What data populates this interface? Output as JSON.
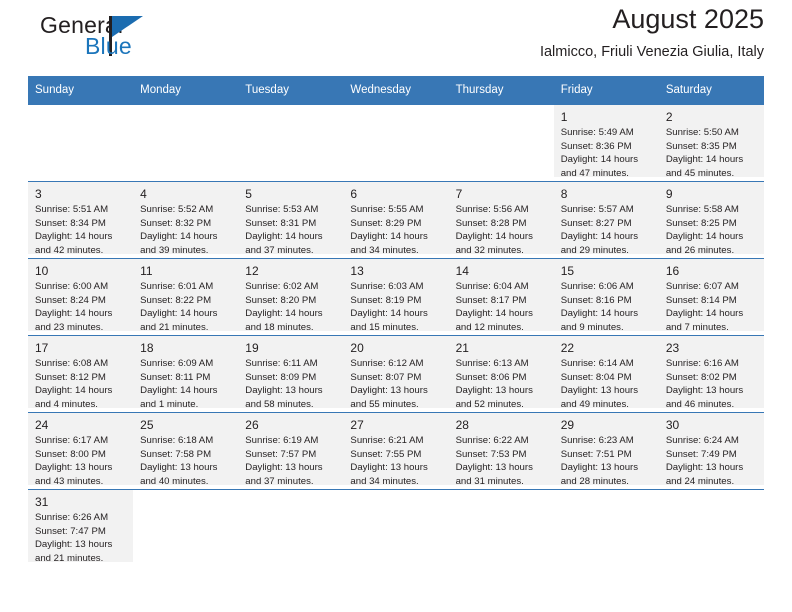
{
  "brand": {
    "name_top": "General",
    "name_bottom": "Blue",
    "color_black": "#231f20",
    "color_blue": "#1b75bb"
  },
  "header": {
    "title": "August 2025",
    "subtitle": "Ialmicco, Friuli Venezia Giulia, Italy"
  },
  "theme": {
    "header_blue": "#3877b5",
    "alt_row_gray": "#f2f2f2"
  },
  "weekdays": [
    "Sunday",
    "Monday",
    "Tuesday",
    "Wednesday",
    "Thursday",
    "Friday",
    "Saturday"
  ],
  "weeks": [
    [
      {
        "day": "",
        "sunrise": "",
        "sunset": "",
        "daylight_line1": "",
        "daylight_line2": ""
      },
      {
        "day": "",
        "sunrise": "",
        "sunset": "",
        "daylight_line1": "",
        "daylight_line2": ""
      },
      {
        "day": "",
        "sunrise": "",
        "sunset": "",
        "daylight_line1": "",
        "daylight_line2": ""
      },
      {
        "day": "",
        "sunrise": "",
        "sunset": "",
        "daylight_line1": "",
        "daylight_line2": ""
      },
      {
        "day": "",
        "sunrise": "",
        "sunset": "",
        "daylight_line1": "",
        "daylight_line2": ""
      },
      {
        "day": "1",
        "sunrise": "Sunrise: 5:49 AM",
        "sunset": "Sunset: 8:36 PM",
        "daylight_line1": "Daylight: 14 hours",
        "daylight_line2": "and 47 minutes."
      },
      {
        "day": "2",
        "sunrise": "Sunrise: 5:50 AM",
        "sunset": "Sunset: 8:35 PM",
        "daylight_line1": "Daylight: 14 hours",
        "daylight_line2": "and 45 minutes."
      }
    ],
    [
      {
        "day": "3",
        "sunrise": "Sunrise: 5:51 AM",
        "sunset": "Sunset: 8:34 PM",
        "daylight_line1": "Daylight: 14 hours",
        "daylight_line2": "and 42 minutes."
      },
      {
        "day": "4",
        "sunrise": "Sunrise: 5:52 AM",
        "sunset": "Sunset: 8:32 PM",
        "daylight_line1": "Daylight: 14 hours",
        "daylight_line2": "and 39 minutes."
      },
      {
        "day": "5",
        "sunrise": "Sunrise: 5:53 AM",
        "sunset": "Sunset: 8:31 PM",
        "daylight_line1": "Daylight: 14 hours",
        "daylight_line2": "and 37 minutes."
      },
      {
        "day": "6",
        "sunrise": "Sunrise: 5:55 AM",
        "sunset": "Sunset: 8:29 PM",
        "daylight_line1": "Daylight: 14 hours",
        "daylight_line2": "and 34 minutes."
      },
      {
        "day": "7",
        "sunrise": "Sunrise: 5:56 AM",
        "sunset": "Sunset: 8:28 PM",
        "daylight_line1": "Daylight: 14 hours",
        "daylight_line2": "and 32 minutes."
      },
      {
        "day": "8",
        "sunrise": "Sunrise: 5:57 AM",
        "sunset": "Sunset: 8:27 PM",
        "daylight_line1": "Daylight: 14 hours",
        "daylight_line2": "and 29 minutes."
      },
      {
        "day": "9",
        "sunrise": "Sunrise: 5:58 AM",
        "sunset": "Sunset: 8:25 PM",
        "daylight_line1": "Daylight: 14 hours",
        "daylight_line2": "and 26 minutes."
      }
    ],
    [
      {
        "day": "10",
        "sunrise": "Sunrise: 6:00 AM",
        "sunset": "Sunset: 8:24 PM",
        "daylight_line1": "Daylight: 14 hours",
        "daylight_line2": "and 23 minutes."
      },
      {
        "day": "11",
        "sunrise": "Sunrise: 6:01 AM",
        "sunset": "Sunset: 8:22 PM",
        "daylight_line1": "Daylight: 14 hours",
        "daylight_line2": "and 21 minutes."
      },
      {
        "day": "12",
        "sunrise": "Sunrise: 6:02 AM",
        "sunset": "Sunset: 8:20 PM",
        "daylight_line1": "Daylight: 14 hours",
        "daylight_line2": "and 18 minutes."
      },
      {
        "day": "13",
        "sunrise": "Sunrise: 6:03 AM",
        "sunset": "Sunset: 8:19 PM",
        "daylight_line1": "Daylight: 14 hours",
        "daylight_line2": "and 15 minutes."
      },
      {
        "day": "14",
        "sunrise": "Sunrise: 6:04 AM",
        "sunset": "Sunset: 8:17 PM",
        "daylight_line1": "Daylight: 14 hours",
        "daylight_line2": "and 12 minutes."
      },
      {
        "day": "15",
        "sunrise": "Sunrise: 6:06 AM",
        "sunset": "Sunset: 8:16 PM",
        "daylight_line1": "Daylight: 14 hours",
        "daylight_line2": "and 9 minutes."
      },
      {
        "day": "16",
        "sunrise": "Sunrise: 6:07 AM",
        "sunset": "Sunset: 8:14 PM",
        "daylight_line1": "Daylight: 14 hours",
        "daylight_line2": "and 7 minutes."
      }
    ],
    [
      {
        "day": "17",
        "sunrise": "Sunrise: 6:08 AM",
        "sunset": "Sunset: 8:12 PM",
        "daylight_line1": "Daylight: 14 hours",
        "daylight_line2": "and 4 minutes."
      },
      {
        "day": "18",
        "sunrise": "Sunrise: 6:09 AM",
        "sunset": "Sunset: 8:11 PM",
        "daylight_line1": "Daylight: 14 hours",
        "daylight_line2": "and 1 minute."
      },
      {
        "day": "19",
        "sunrise": "Sunrise: 6:11 AM",
        "sunset": "Sunset: 8:09 PM",
        "daylight_line1": "Daylight: 13 hours",
        "daylight_line2": "and 58 minutes."
      },
      {
        "day": "20",
        "sunrise": "Sunrise: 6:12 AM",
        "sunset": "Sunset: 8:07 PM",
        "daylight_line1": "Daylight: 13 hours",
        "daylight_line2": "and 55 minutes."
      },
      {
        "day": "21",
        "sunrise": "Sunrise: 6:13 AM",
        "sunset": "Sunset: 8:06 PM",
        "daylight_line1": "Daylight: 13 hours",
        "daylight_line2": "and 52 minutes."
      },
      {
        "day": "22",
        "sunrise": "Sunrise: 6:14 AM",
        "sunset": "Sunset: 8:04 PM",
        "daylight_line1": "Daylight: 13 hours",
        "daylight_line2": "and 49 minutes."
      },
      {
        "day": "23",
        "sunrise": "Sunrise: 6:16 AM",
        "sunset": "Sunset: 8:02 PM",
        "daylight_line1": "Daylight: 13 hours",
        "daylight_line2": "and 46 minutes."
      }
    ],
    [
      {
        "day": "24",
        "sunrise": "Sunrise: 6:17 AM",
        "sunset": "Sunset: 8:00 PM",
        "daylight_line1": "Daylight: 13 hours",
        "daylight_line2": "and 43 minutes."
      },
      {
        "day": "25",
        "sunrise": "Sunrise: 6:18 AM",
        "sunset": "Sunset: 7:58 PM",
        "daylight_line1": "Daylight: 13 hours",
        "daylight_line2": "and 40 minutes."
      },
      {
        "day": "26",
        "sunrise": "Sunrise: 6:19 AM",
        "sunset": "Sunset: 7:57 PM",
        "daylight_line1": "Daylight: 13 hours",
        "daylight_line2": "and 37 minutes."
      },
      {
        "day": "27",
        "sunrise": "Sunrise: 6:21 AM",
        "sunset": "Sunset: 7:55 PM",
        "daylight_line1": "Daylight: 13 hours",
        "daylight_line2": "and 34 minutes."
      },
      {
        "day": "28",
        "sunrise": "Sunrise: 6:22 AM",
        "sunset": "Sunset: 7:53 PM",
        "daylight_line1": "Daylight: 13 hours",
        "daylight_line2": "and 31 minutes."
      },
      {
        "day": "29",
        "sunrise": "Sunrise: 6:23 AM",
        "sunset": "Sunset: 7:51 PM",
        "daylight_line1": "Daylight: 13 hours",
        "daylight_line2": "and 28 minutes."
      },
      {
        "day": "30",
        "sunrise": "Sunrise: 6:24 AM",
        "sunset": "Sunset: 7:49 PM",
        "daylight_line1": "Daylight: 13 hours",
        "daylight_line2": "and 24 minutes."
      }
    ],
    [
      {
        "day": "31",
        "sunrise": "Sunrise: 6:26 AM",
        "sunset": "Sunset: 7:47 PM",
        "daylight_line1": "Daylight: 13 hours",
        "daylight_line2": "and 21 minutes."
      },
      {
        "day": "",
        "sunrise": "",
        "sunset": "",
        "daylight_line1": "",
        "daylight_line2": ""
      },
      {
        "day": "",
        "sunrise": "",
        "sunset": "",
        "daylight_line1": "",
        "daylight_line2": ""
      },
      {
        "day": "",
        "sunrise": "",
        "sunset": "",
        "daylight_line1": "",
        "daylight_line2": ""
      },
      {
        "day": "",
        "sunrise": "",
        "sunset": "",
        "daylight_line1": "",
        "daylight_line2": ""
      },
      {
        "day": "",
        "sunrise": "",
        "sunset": "",
        "daylight_line1": "",
        "daylight_line2": ""
      },
      {
        "day": "",
        "sunrise": "",
        "sunset": "",
        "daylight_line1": "",
        "daylight_line2": ""
      }
    ]
  ]
}
